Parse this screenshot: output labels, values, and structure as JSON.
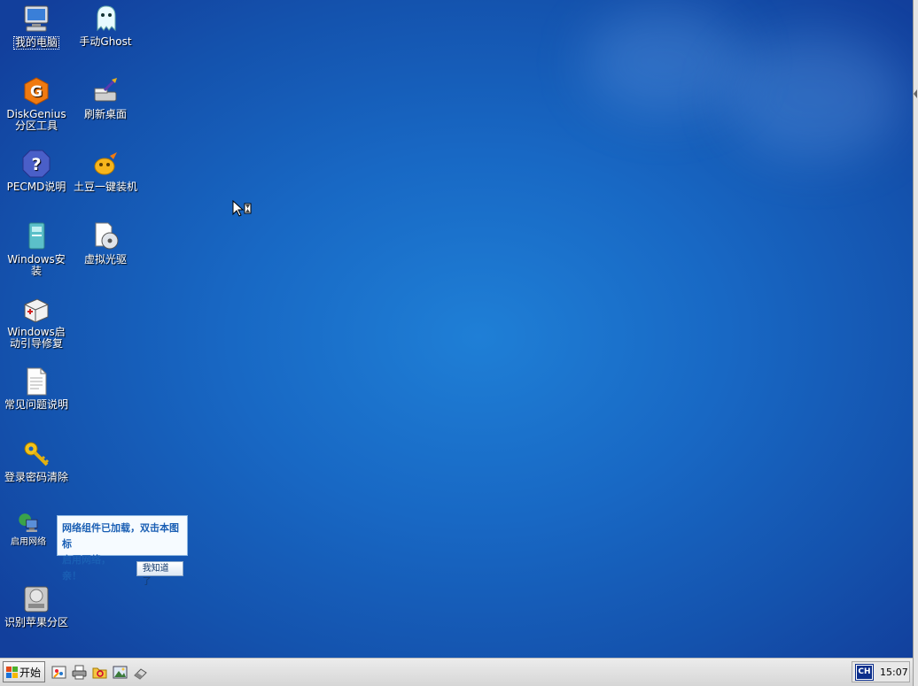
{
  "desktop": {
    "icons": [
      {
        "name": "my-computer",
        "label": "我的电脑",
        "icon": "computer-icon"
      },
      {
        "name": "manual-ghost",
        "label": "手动Ghost",
        "icon": "ghost-icon"
      },
      {
        "name": "diskgenius",
        "label": "DiskGenius分区工具",
        "icon": "diskgenius-icon"
      },
      {
        "name": "refresh-desktop",
        "label": "刷新桌面",
        "icon": "brush-icon"
      },
      {
        "name": "pecmd-help",
        "label": "PECMD说明",
        "icon": "help-icon"
      },
      {
        "name": "tudou-install",
        "label": "土豆一键装机",
        "icon": "tudou-icon"
      },
      {
        "name": "windows-install",
        "label": "Windows安装",
        "icon": "install-icon"
      },
      {
        "name": "virtual-drive",
        "label": "虚拟光驱",
        "icon": "virtual-cd-icon"
      },
      {
        "name": "boot-repair",
        "label": "Windows启动引导修复",
        "icon": "repair-kit-icon"
      },
      {
        "name": "faq",
        "label": "常见问题说明",
        "icon": "document-icon"
      },
      {
        "name": "password-clear",
        "label": "登录密码清除",
        "icon": "key-icon"
      },
      {
        "name": "enable-network",
        "label": "启用网络",
        "icon": "network-icon"
      },
      {
        "name": "apple-partition",
        "label": "识别苹果分区",
        "icon": "hard-drive-icon"
      }
    ]
  },
  "notification": {
    "line1": "网络组件已加载，双击本图标",
    "line2": "启用网络，亲！",
    "button": "我知道了"
  },
  "taskbar": {
    "start_label": "开始",
    "quick_launch": [
      "paint-icon",
      "printer-icon",
      "explorer-icon",
      "image-viewer-icon",
      "eraser-icon"
    ],
    "language": "CH",
    "clock": "15:07"
  },
  "colors": {
    "desktop_center": "#1f7fd6",
    "desktop_edge": "#123f9c",
    "taskbar": "#e0e0e0",
    "balloon_text": "#1a5fb4"
  }
}
